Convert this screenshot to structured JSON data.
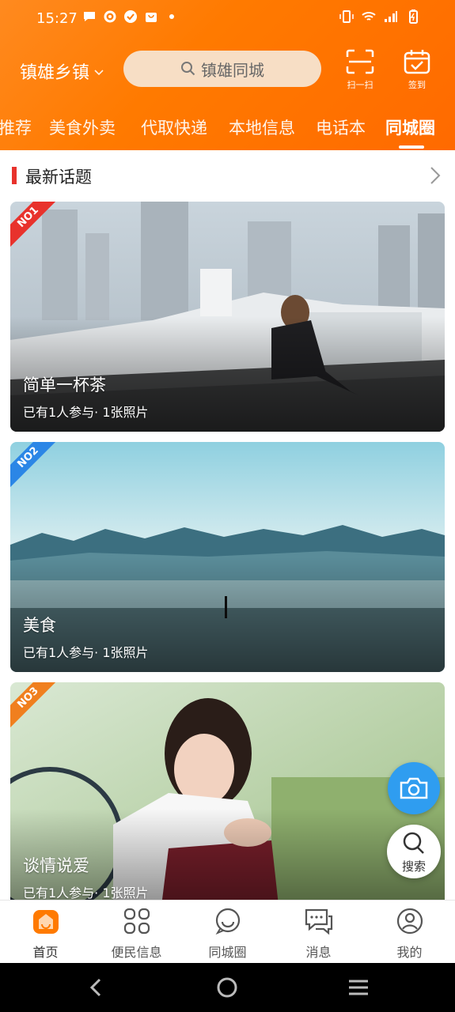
{
  "status": {
    "time": "15:27"
  },
  "header": {
    "location": "镇雄乡镇",
    "search_placeholder": "镇雄同城",
    "scan_label": "扫一扫",
    "signin_label": "签到"
  },
  "tabs": [
    {
      "label": "推荐"
    },
    {
      "label": "美食外卖"
    },
    {
      "label": "代取快递"
    },
    {
      "label": "本地信息"
    },
    {
      "label": "电话本"
    },
    {
      "label": "同城圈",
      "active": true
    }
  ],
  "section": {
    "title": "最新话题"
  },
  "topics": [
    {
      "rank": "NO1",
      "title": "简单一杯茶",
      "meta": "已有1人参与· 1张照片",
      "rank_color": "#e8322c"
    },
    {
      "rank": "NO2",
      "title": "美食",
      "meta": "已有1人参与· 1张照片",
      "rank_color": "#2b86e6"
    },
    {
      "rank": "NO3",
      "title": "谈情说爱",
      "meta": "已有1人参与· 1张照片",
      "rank_color": "#f07f1e"
    }
  ],
  "fab": {
    "search_label": "搜索"
  },
  "bottom_nav": [
    {
      "label": "首页",
      "icon": "home-icon",
      "active": true
    },
    {
      "label": "便民信息",
      "icon": "grid-icon"
    },
    {
      "label": "同城圈",
      "icon": "chat-smile-icon"
    },
    {
      "label": "消息",
      "icon": "message-icon"
    },
    {
      "label": "我的",
      "icon": "profile-icon"
    }
  ],
  "colors": {
    "brand_orange": "#ff7a00",
    "accent_red": "#e8322c",
    "fab_blue": "#2f9df0"
  }
}
